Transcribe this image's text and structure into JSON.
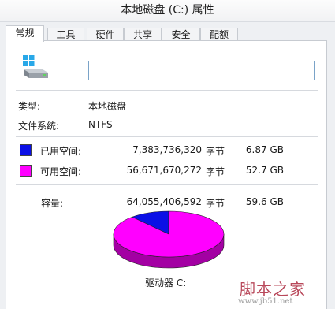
{
  "window": {
    "title": "本地磁盘 (C:) 属性"
  },
  "tabs": [
    {
      "label": "常规"
    },
    {
      "label": "工具"
    },
    {
      "label": "硬件"
    },
    {
      "label": "共享"
    },
    {
      "label": "安全"
    },
    {
      "label": "配额"
    }
  ],
  "drive_name_field": {
    "value": ""
  },
  "info": {
    "type_label": "类型:",
    "type_value": "本地磁盘",
    "fs_label": "文件系统:",
    "fs_value": "NTFS"
  },
  "space": {
    "used": {
      "label": "已用空间:",
      "bytes": "7,383,736,320",
      "unit": "字节",
      "size": "6.87 GB",
      "color": "#0b10e6"
    },
    "free": {
      "label": "可用空间:",
      "bytes": "56,671,670,272",
      "unit": "字节",
      "size": "52.7 GB",
      "color": "#ff00ff"
    },
    "total": {
      "label": "容量:",
      "bytes": "64,055,406,592",
      "unit": "字节",
      "size": "59.6 GB"
    }
  },
  "drive_caption": "驱动器 C:",
  "chart_data": {
    "type": "pie",
    "categories": [
      "已用空间",
      "可用空间"
    ],
    "values": [
      7383736320,
      56671670272
    ]
  },
  "watermark": {
    "text": "脚本之家",
    "url": "www.jb51.net"
  }
}
